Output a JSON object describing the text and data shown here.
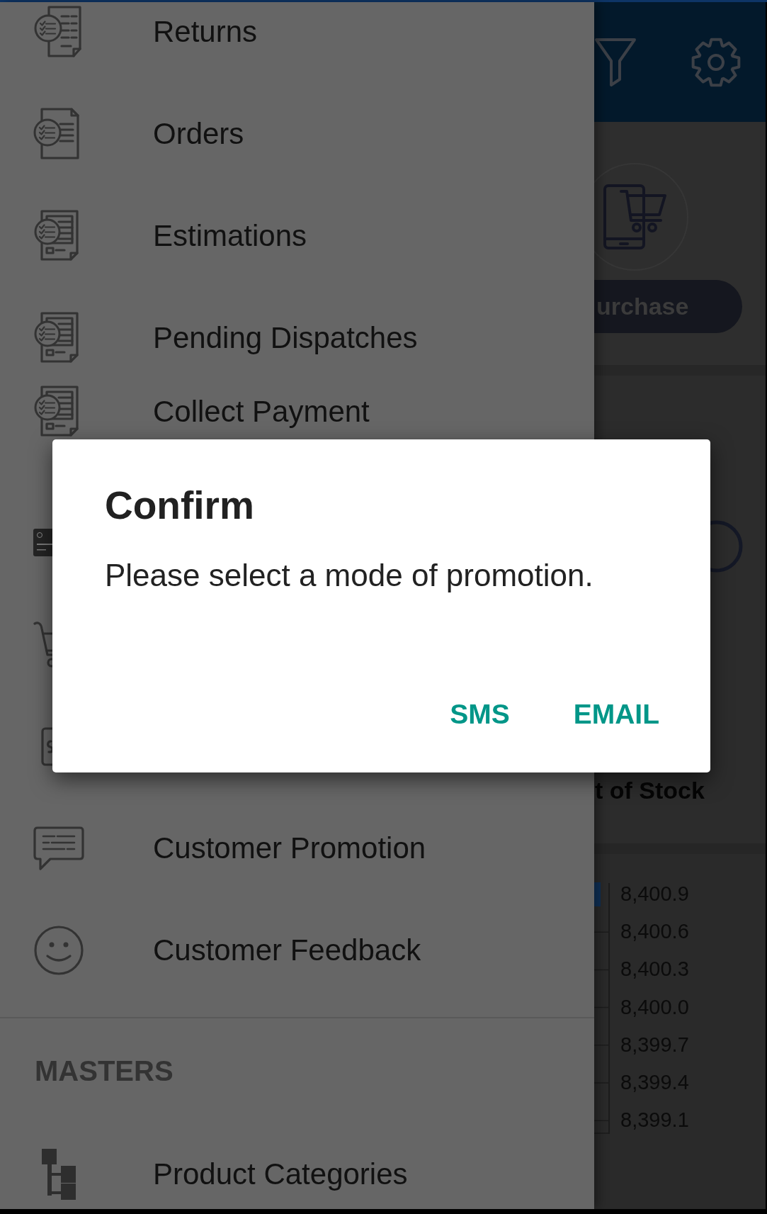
{
  "drawer": {
    "items": [
      {
        "kind": "entry",
        "label": "Returns"
      },
      {
        "kind": "entry",
        "label": "Orders"
      },
      {
        "kind": "entry",
        "label": "Estimations"
      },
      {
        "kind": "entry",
        "label": "Pending Dispatches"
      },
      {
        "kind": "entry",
        "label": "Collect Payment"
      },
      {
        "kind": "covered"
      },
      {
        "kind": "covered"
      },
      {
        "kind": "covered"
      },
      {
        "kind": "entry",
        "label": "Customer Promotion"
      },
      {
        "kind": "entry",
        "label": "Customer Feedback"
      }
    ],
    "sections": [
      {
        "title": "MASTERS",
        "items": [
          {
            "kind": "entry",
            "label": "Product Categories"
          }
        ]
      }
    ]
  },
  "background": {
    "purchase_button": "urchase",
    "stock_label": "t of Stock",
    "chart": {
      "axis_labels": [
        "8,400.9",
        "8,400.6",
        "8,400.3",
        "8,400.0",
        "8,399.7",
        "8,399.4",
        "8,399.1"
      ]
    }
  },
  "dialog": {
    "title": "Confirm",
    "message": "Please select a mode of promotion.",
    "buttons": [
      "SMS",
      "EMAIL"
    ]
  }
}
